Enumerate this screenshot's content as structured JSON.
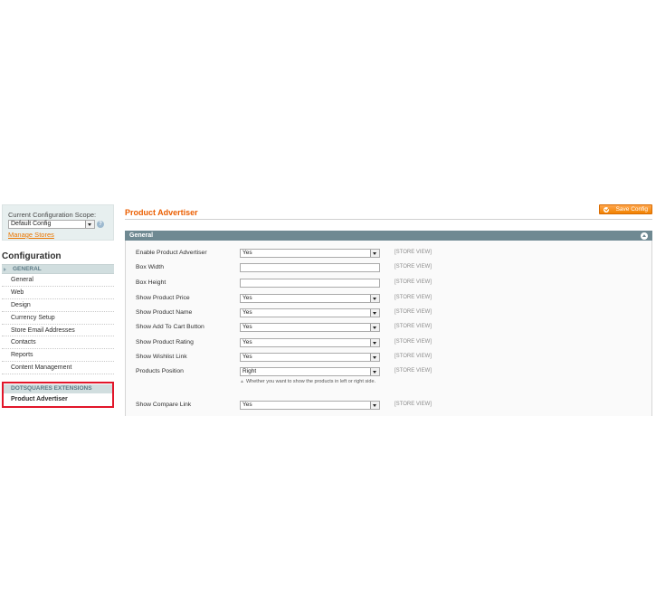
{
  "sidebar": {
    "scope_label": "Current Configuration Scope:",
    "scope_value": "Default Config",
    "manage_stores": "Manage Stores",
    "title": "Configuration",
    "section_general": "GENERAL",
    "items": [
      "General",
      "Web",
      "Design",
      "Currency Setup",
      "Store Email Addresses",
      "Contacts",
      "Reports",
      "Content Management"
    ],
    "section_ext": "DOTSQUARES EXTENSIONS",
    "ext_item": "Product Advertiser"
  },
  "main": {
    "title": "Product Advertiser",
    "save_label": "Save Config",
    "section_title": "General",
    "scope_text": "[STORE VIEW]",
    "fields": [
      {
        "label": "Enable Product Advertiser",
        "value": "Yes"
      },
      {
        "label": "Box Width",
        "value": ""
      },
      {
        "label": "Box Height",
        "value": ""
      },
      {
        "label": "Show Product Price",
        "value": "Yes"
      },
      {
        "label": "Show Product Name",
        "value": "Yes"
      },
      {
        "label": "Show Add To Cart Button",
        "value": "Yes"
      },
      {
        "label": "Show Product Rating",
        "value": "Yes"
      },
      {
        "label": "Show Wishlist Link",
        "value": "Yes"
      },
      {
        "label": "Products Position",
        "value": "Right"
      },
      {
        "label": "Show Compare Link",
        "value": "Yes"
      }
    ],
    "position_hint": "Whether you want to show the products in left or right side."
  },
  "colors": {
    "accent": "#eb5e00",
    "section_bar": "#6f8992",
    "highlight_border": "#e2162a"
  }
}
